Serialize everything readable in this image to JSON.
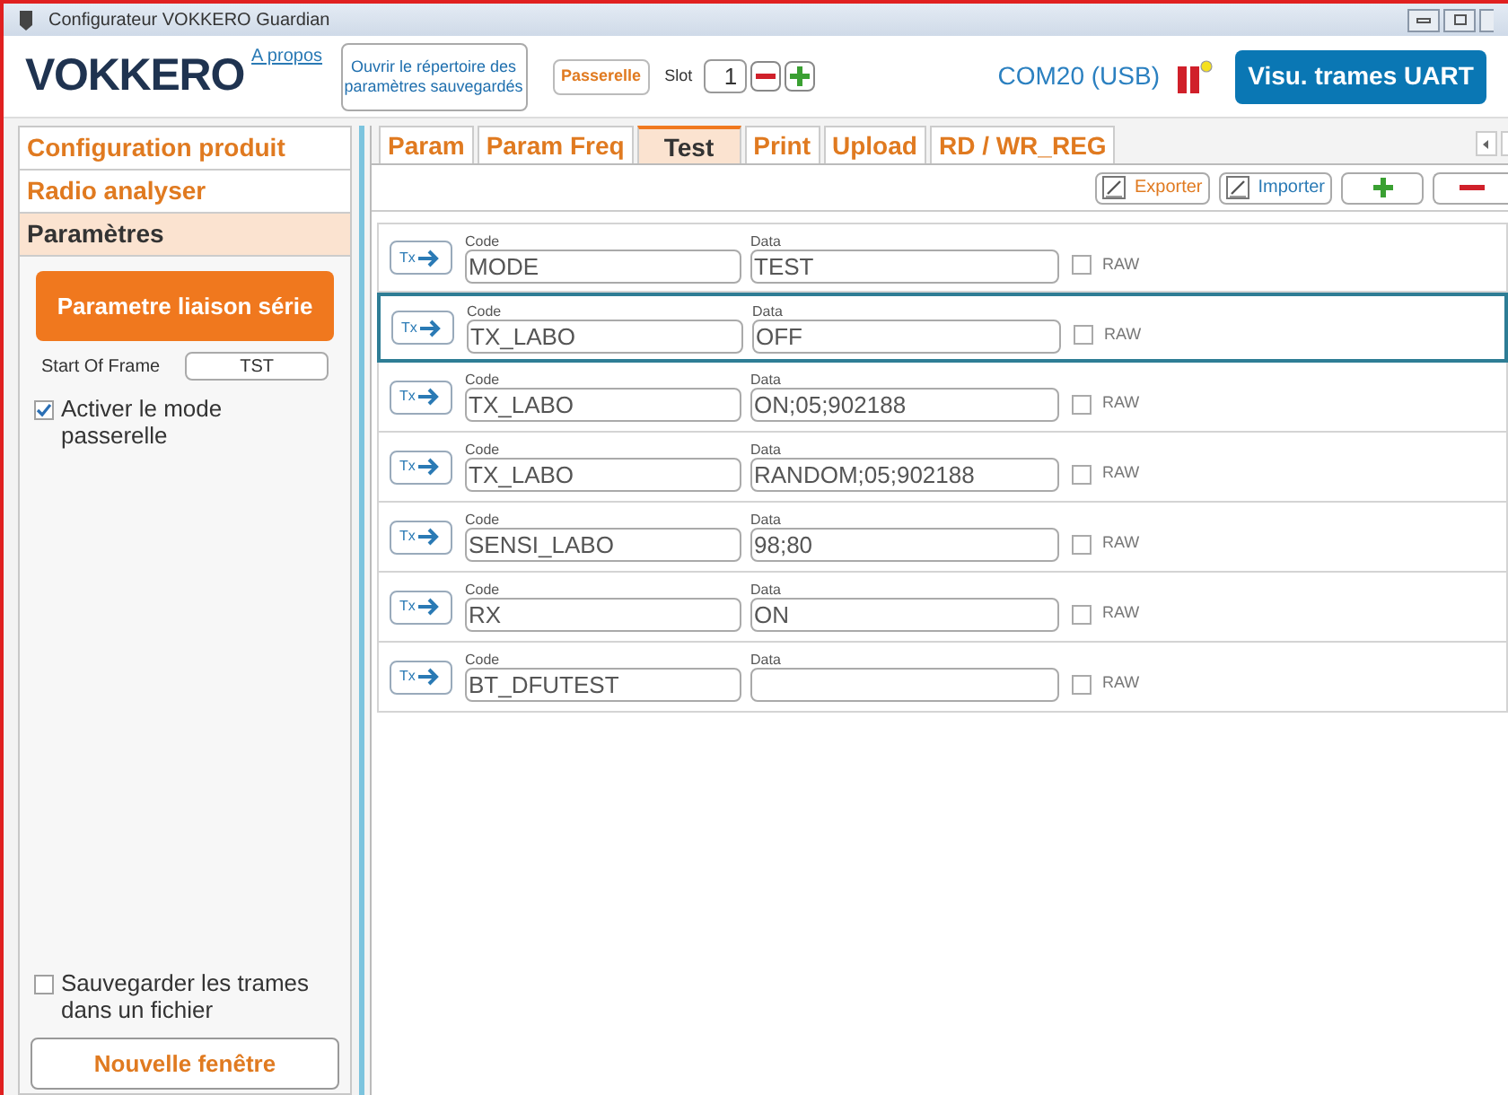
{
  "window": {
    "title": "Configurateur VOKKERO Guardian"
  },
  "header": {
    "logo": "VOKKERO",
    "about_link": "A propos",
    "open_folder_button": "Ouvrir le répertoire des paramètres sauvegardés",
    "gateway_button": "Passerelle",
    "slot_label": "Slot",
    "slot_value": "1",
    "port": "COM20 (USB)",
    "uart_button": "Visu. trames UART"
  },
  "sidebar": {
    "sections": [
      {
        "label": "Configuration produit",
        "selected": false
      },
      {
        "label": "Radio analyser",
        "selected": false
      },
      {
        "label": "Paramètres",
        "selected": true
      }
    ],
    "serial_button": "Parametre liaison série",
    "start_of_frame_label": "Start Of Frame",
    "start_of_frame_value": "TST",
    "gateway_mode": {
      "label": "Activer le mode passerelle",
      "checked": true
    },
    "save_frames": {
      "label": "Sauvegarder les trames dans un fichier",
      "checked": false
    },
    "new_window_button": "Nouvelle fenêtre"
  },
  "tabs": [
    {
      "label": "Param",
      "selected": false
    },
    {
      "label": "Param Freq",
      "selected": false
    },
    {
      "label": "Test",
      "selected": true
    },
    {
      "label": "Print",
      "selected": false
    },
    {
      "label": "Upload",
      "selected": false
    },
    {
      "label": "RD / WR_REG",
      "selected": false
    }
  ],
  "toolbar": {
    "export_button": "Exporter",
    "import_button": "Importer"
  },
  "rows": [
    {
      "tx": "Tx",
      "code_label": "Code",
      "code": "MODE",
      "data_label": "Data",
      "data": "TEST",
      "raw_label": "RAW",
      "raw": false,
      "selected": false
    },
    {
      "tx": "Tx",
      "code_label": "Code",
      "code": "TX_LABO",
      "data_label": "Data",
      "data": "OFF",
      "raw_label": "RAW",
      "raw": false,
      "selected": true
    },
    {
      "tx": "Tx",
      "code_label": "Code",
      "code": "TX_LABO",
      "data_label": "Data",
      "data": "ON;05;902188",
      "raw_label": "RAW",
      "raw": false,
      "selected": false
    },
    {
      "tx": "Tx",
      "code_label": "Code",
      "code": "TX_LABO",
      "data_label": "Data",
      "data": "RANDOM;05;902188",
      "raw_label": "RAW",
      "raw": false,
      "selected": false
    },
    {
      "tx": "Tx",
      "code_label": "Code",
      "code": "SENSI_LABO",
      "data_label": "Data",
      "data": "98;80",
      "raw_label": "RAW",
      "raw": false,
      "selected": false
    },
    {
      "tx": "Tx",
      "code_label": "Code",
      "code": "RX",
      "data_label": "Data",
      "data": "ON",
      "raw_label": "RAW",
      "raw": false,
      "selected": false
    },
    {
      "tx": "Tx",
      "code_label": "Code",
      "code": "BT_DFUTEST",
      "data_label": "Data",
      "data": "",
      "raw_label": "RAW",
      "raw": false,
      "selected": false
    }
  ]
}
